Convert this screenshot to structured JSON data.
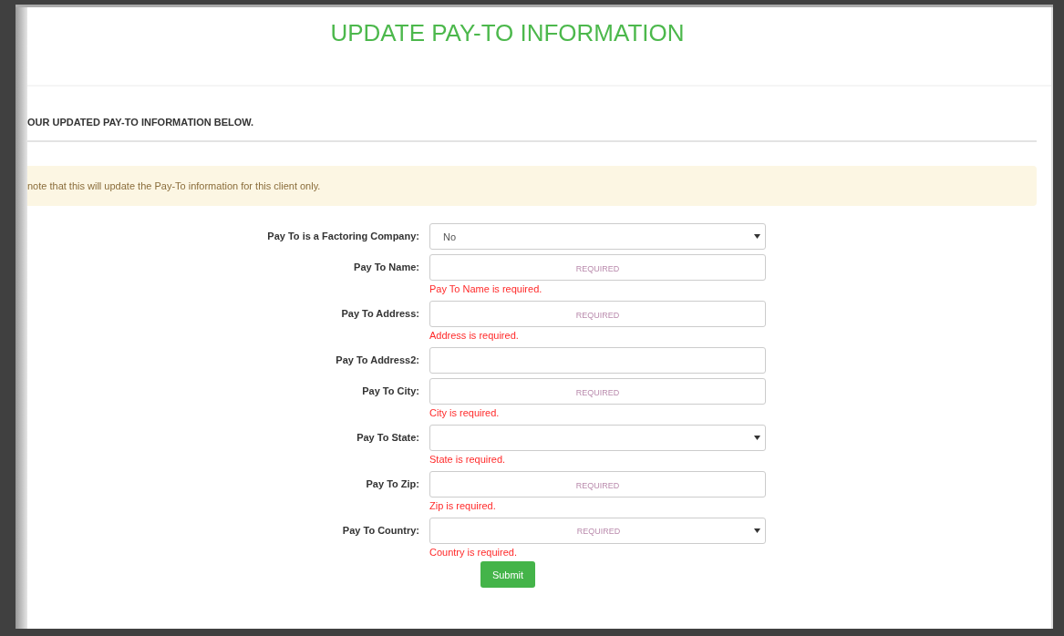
{
  "title": "UPDATE PAY-TO INFORMATION",
  "subtitle": "OUR UPDATED PAY-TO INFORMATION BELOW.",
  "notice": "note that this will update the Pay-To information for this client only.",
  "fields": [
    {
      "label": "Pay To is a Factoring Company:",
      "kind": "select",
      "value": "No"
    },
    {
      "label": "Pay To Name:",
      "kind": "text",
      "placeholder": "REQUIRED",
      "error": "Pay To Name is required."
    },
    {
      "label": "Pay To Address:",
      "kind": "text",
      "placeholder": "REQUIRED",
      "error": "Address is required."
    },
    {
      "label": "Pay To Address2:",
      "kind": "text"
    },
    {
      "label": "Pay To City:",
      "kind": "text",
      "placeholder": "REQUIRED",
      "error": "City is required."
    },
    {
      "label": "Pay To State:",
      "kind": "select",
      "error": "State is required."
    },
    {
      "label": "Pay To Zip:",
      "kind": "text",
      "placeholder": "REQUIRED",
      "error": "Zip is required."
    },
    {
      "label": "Pay To Country:",
      "kind": "select",
      "placeholder": "REQUIRED",
      "error": "Country is required."
    }
  ],
  "submit": "Submit"
}
